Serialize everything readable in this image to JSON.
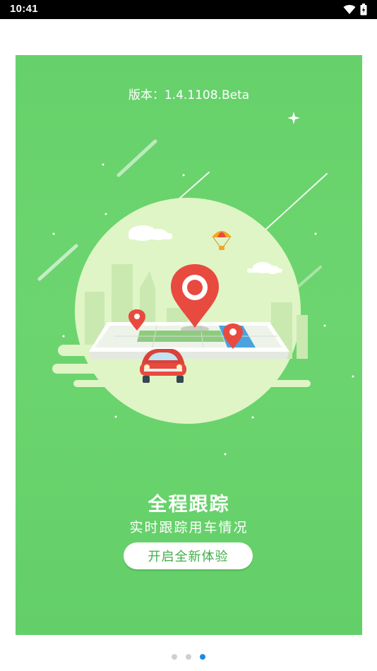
{
  "status_bar": {
    "time": "10:41",
    "icons": [
      "wifi-icon",
      "battery-icon"
    ]
  },
  "splash": {
    "version": "版本：1.4.1108.Beta",
    "title": "全程跟踪",
    "subtitle": "实时跟踪用车情况",
    "start_button": "开启全新体验",
    "illustration": "location-tracking-car-map"
  },
  "pager": {
    "count": 3,
    "active_index": 2
  },
  "colors": {
    "card_background": "#6dd56f",
    "button_text": "#3fae47",
    "pin": "#e94a3f",
    "active_dot": "#1e88e5",
    "inactive_dot": "#d0d0d0"
  }
}
